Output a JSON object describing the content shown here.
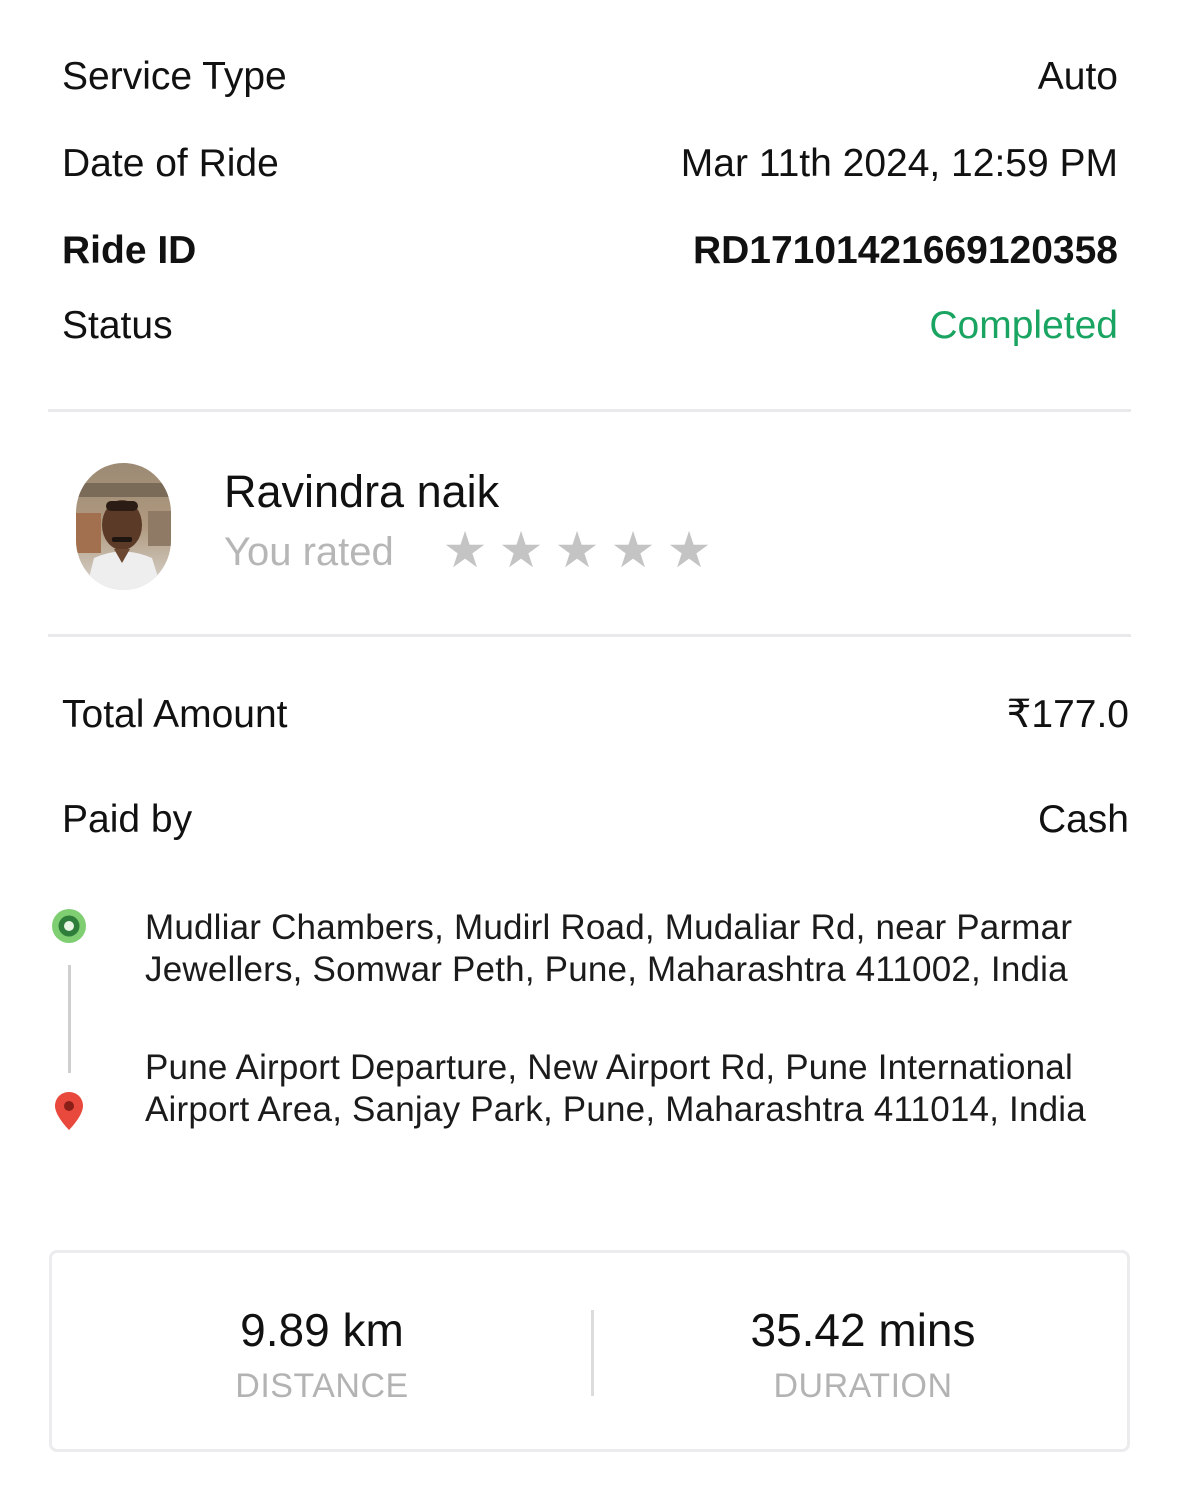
{
  "details": {
    "service_type_label": "Service Type",
    "service_type_value": "Auto",
    "date_label": "Date of Ride",
    "date_value": "Mar 11th 2024, 12:59 PM",
    "ride_id_label": "Ride ID",
    "ride_id_value": "RD17101421669120358",
    "status_label": "Status",
    "status_value": "Completed",
    "status_color": "#1aa461"
  },
  "driver": {
    "name": "Ravindra naik",
    "rated_label": "You rated",
    "rating": 0,
    "max_rating": 5,
    "star_glyph": "★"
  },
  "payment": {
    "total_label": "Total Amount",
    "total_value": "₹177.0",
    "paid_by_label": "Paid by",
    "paid_by_value": "Cash"
  },
  "route": {
    "pickup": "Mudliar Chambers, Mudirl Road, Mudaliar Rd, near Parmar Jewellers, Somwar Peth, Pune, Maharashtra 411002, India",
    "drop": "Pune Airport Departure, New Airport Rd, Pune International Airport Area, Sanjay Park, Pune, Maharashtra 411014, India",
    "pickup_icon": "green-pin-icon",
    "drop_icon": "red-map-pin-icon"
  },
  "stats": {
    "distance_value": "9.89 km",
    "distance_label": "DISTANCE",
    "duration_value": "35.42 mins",
    "duration_label": "DURATION"
  }
}
